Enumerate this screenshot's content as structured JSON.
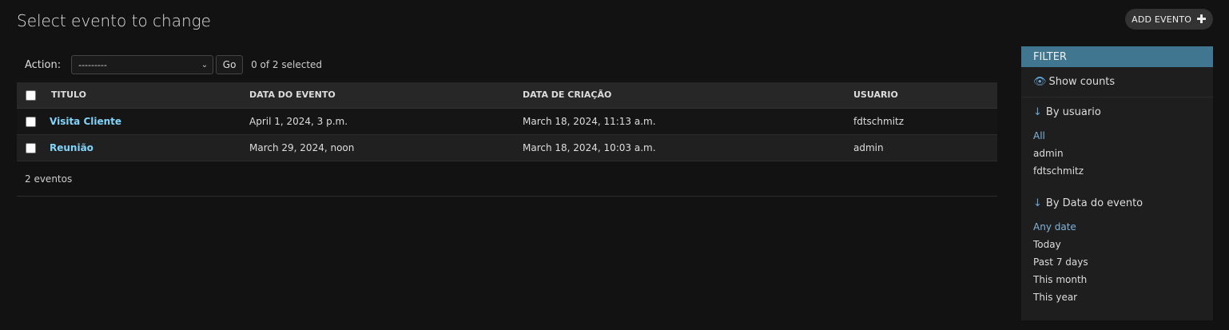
{
  "header": {
    "title": "Select evento to change",
    "add_button": "ADD EVENTO"
  },
  "actions": {
    "label": "Action:",
    "selected_option": "---------",
    "go": "Go",
    "selection_count": "0 of 2 selected"
  },
  "table": {
    "columns": [
      "TITULO",
      "DATA DO EVENTO",
      "DATA DE CRIAÇÃO",
      "USUARIO"
    ],
    "rows": [
      {
        "titulo": "Visita Cliente",
        "data_evento": "April 1, 2024, 3 p.m.",
        "data_criacao": "March 18, 2024, 11:13 a.m.",
        "usuario": "fdtschmitz"
      },
      {
        "titulo": "Reunião",
        "data_evento": "March 29, 2024, noon",
        "data_criacao": "March 18, 2024, 10:03 a.m.",
        "usuario": "admin"
      }
    ]
  },
  "result_count": "2 eventos",
  "filter": {
    "title": "FILTER",
    "show_counts": "Show counts",
    "groups": [
      {
        "title": "By usuario",
        "items": [
          "All",
          "admin",
          "fdtschmitz"
        ]
      },
      {
        "title": "By Data do evento",
        "items": [
          "Any date",
          "Today",
          "Past 7 days",
          "This month",
          "This year"
        ]
      }
    ]
  }
}
